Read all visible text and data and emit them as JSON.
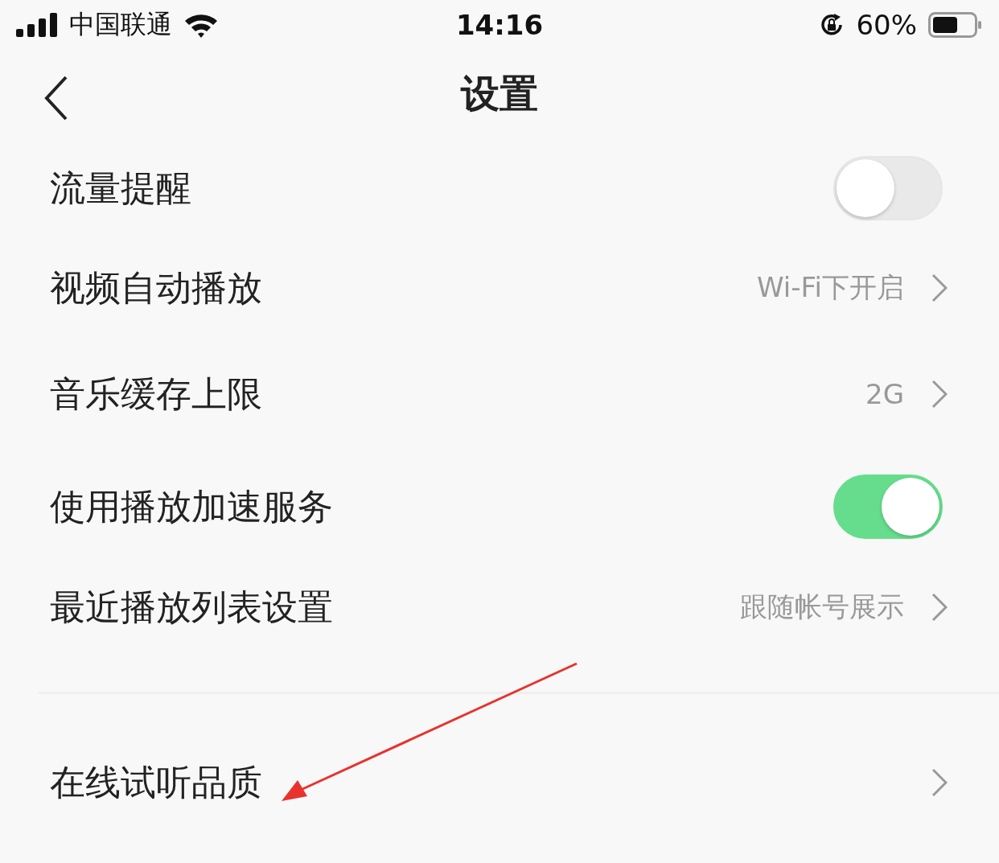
{
  "status_bar": {
    "carrier": "中国联通",
    "time": "14:16",
    "battery_percent": "60%"
  },
  "nav": {
    "title": "设置"
  },
  "rows": [
    {
      "kind": "toggle",
      "label": "流量提醒",
      "on": false
    },
    {
      "kind": "link",
      "label": "视频自动播放",
      "value": "Wi-Fi下开启"
    },
    {
      "kind": "link",
      "label": "音乐缓存上限",
      "value": "2G"
    },
    {
      "kind": "toggle",
      "label": "使用播放加速服务",
      "on": true
    },
    {
      "kind": "link",
      "label": "最近播放列表设置",
      "value": "跟随帐号展示"
    }
  ],
  "section2": [
    {
      "kind": "link",
      "label": "在线试听品质"
    }
  ]
}
